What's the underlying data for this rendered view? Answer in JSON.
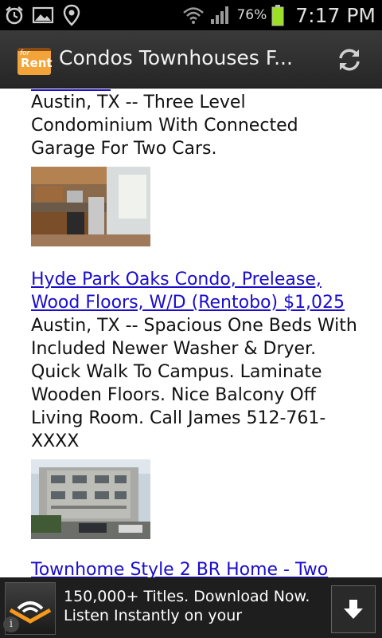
{
  "status_bar": {
    "battery_percent": "76%",
    "time": "7:17 PM",
    "icons": [
      "alarm-icon",
      "gallery-icon",
      "location-icon",
      "wifi-icon",
      "signal-icon",
      "battery-icon"
    ]
  },
  "action_bar": {
    "app_icon_label_small": "for",
    "app_icon_label": "Rent",
    "title": "Condos Townhouses F...",
    "refresh_icon": "refresh-icon"
  },
  "listings": [
    {
      "link": "",
      "description": "Austin, TX -- Three Level Condominium With Connected Garage For Two Cars.",
      "image": "kitchen-photo"
    },
    {
      "link": "Hyde Park Oaks Condo, Prelease, Wood Floors, W/D (Rentobo) $1,025",
      "description": "Austin, TX -- Spacious One Beds With Included Newer Washer & Dryer. Quick Walk To Campus. Laminate Wooden Floors. Nice Balcony Off Living Room. Call James 512-761-XXXX",
      "image": "apartment-building-photo"
    },
    {
      "link": "Townhome Style 2 BR Home - Two",
      "description": "",
      "image": ""
    }
  ],
  "ad": {
    "text": "150,000+ Titles. Download Now. Listen Instantly on your",
    "info_label": "i",
    "icons": [
      "audible-logo-icon",
      "download-arrow-icon",
      "info-icon"
    ]
  },
  "colors": {
    "link": "#1a0dcc",
    "action_bar": "#2e2e2e",
    "status_bar": "#000000",
    "battery_fill": "#9be021",
    "app_icon": "#f2a33a"
  }
}
